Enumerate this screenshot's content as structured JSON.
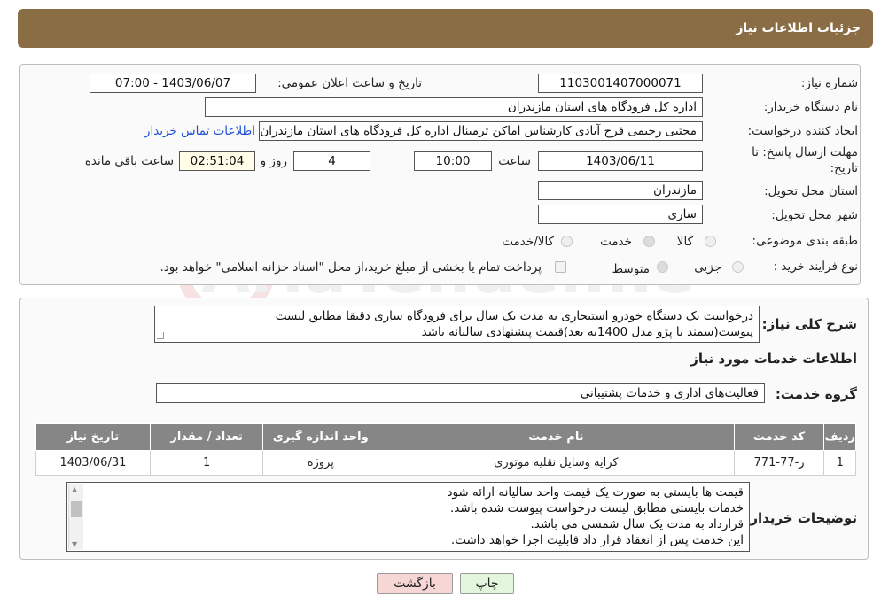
{
  "header": {
    "title": "جزئیات اطلاعات نیاز"
  },
  "form": {
    "need_number_label": "شماره نیاز:",
    "need_number": "1103001407000071",
    "announce_label": "تاریخ و ساعت اعلان عمومی:",
    "announce_value": "1403/06/07 - 07:00",
    "buyer_org_label": "نام دستگاه خریدار:",
    "buyer_org": "اداره کل فرودگاه های استان مازندران",
    "creator_label": "ایجاد کننده درخواست:",
    "creator": "مجتبی رحیمی فرح آبادی کارشناس اماکن ترمینال اداره کل فرودگاه های استان مازندران",
    "contact_link": "اطلاعات تماس خریدار",
    "deadline_label_line1": "مهلت ارسال پاسخ: تا",
    "deadline_label_line2": "تاریخ:",
    "deadline_date": "1403/06/11",
    "time_label": "ساعت",
    "deadline_time": "10:00",
    "days_value": "4",
    "days_label": "روز و",
    "remaining_time": "02:51:04",
    "remaining_label": "ساعت باقی مانده",
    "province_label": "استان محل تحویل:",
    "province": "مازندران",
    "city_label": "شهر محل تحویل:",
    "city": "ساری",
    "category_label": "طبقه بندی موضوعی:",
    "category_options": [
      "کالا",
      "خدمت",
      "کالا/خدمت"
    ],
    "purchase_type_label": "نوع فرآیند خرید :",
    "purchase_options": [
      "جزیی",
      "متوسط"
    ],
    "payment_note": "پرداخت تمام یا بخشی از مبلغ خرید،از محل \"اسناد خزانه اسلامی\" خواهد بود."
  },
  "details": {
    "summary_label": "شرح کلی نیاز:",
    "summary_text_line1": "درخواست یک دستگاه خودرو استیجاری به مدت یک سال برای فرودگاه ساری دقیقا مطابق لیست",
    "summary_text_line2": "پیوست(سمند یا پژو مدل 1400به بعد)قیمت پیشنهادی سالیانه باشد",
    "services_info_title": "اطلاعات خدمات مورد نیاز",
    "service_group_label": "گروه خدمت:",
    "service_group": "فعالیت‌های اداری و خدمات پشتیبانی"
  },
  "table": {
    "headers": [
      "ردیف",
      "کد خدمت",
      "نام خدمت",
      "واحد اندازه گیری",
      "تعداد / مقدار",
      "تاریخ نیاز"
    ],
    "rows": [
      [
        "1",
        "ز-77-771",
        "کرایه وسایل نقلیه موتوری",
        "پروژه",
        "1",
        "1403/06/31"
      ]
    ]
  },
  "buyer_notes": {
    "label": "توضیحات خریدار:",
    "lines": [
      "قیمت ها بایستی به صورت یک قیمت واحد سالیانه ارائه شود",
      "خدمات بایستی مطابق لیست درخواست پیوست شده باشد.",
      "قرارداد به مدت یک سال شمسی می باشد.",
      "این خدمت پس از انعقاد قرار داد قابلیت اجرا خواهد داشت."
    ]
  },
  "buttons": {
    "print": "چاپ",
    "back": "بازگشت"
  },
  "watermark": {
    "text": "AriaTender.neT"
  },
  "colors": {
    "header_bg": "#8b6d45",
    "link": "#1a4fd6",
    "table_header": "#868686",
    "back_button_bg": "#f7d6d6",
    "print_button_bg": "#e3f5dd"
  }
}
